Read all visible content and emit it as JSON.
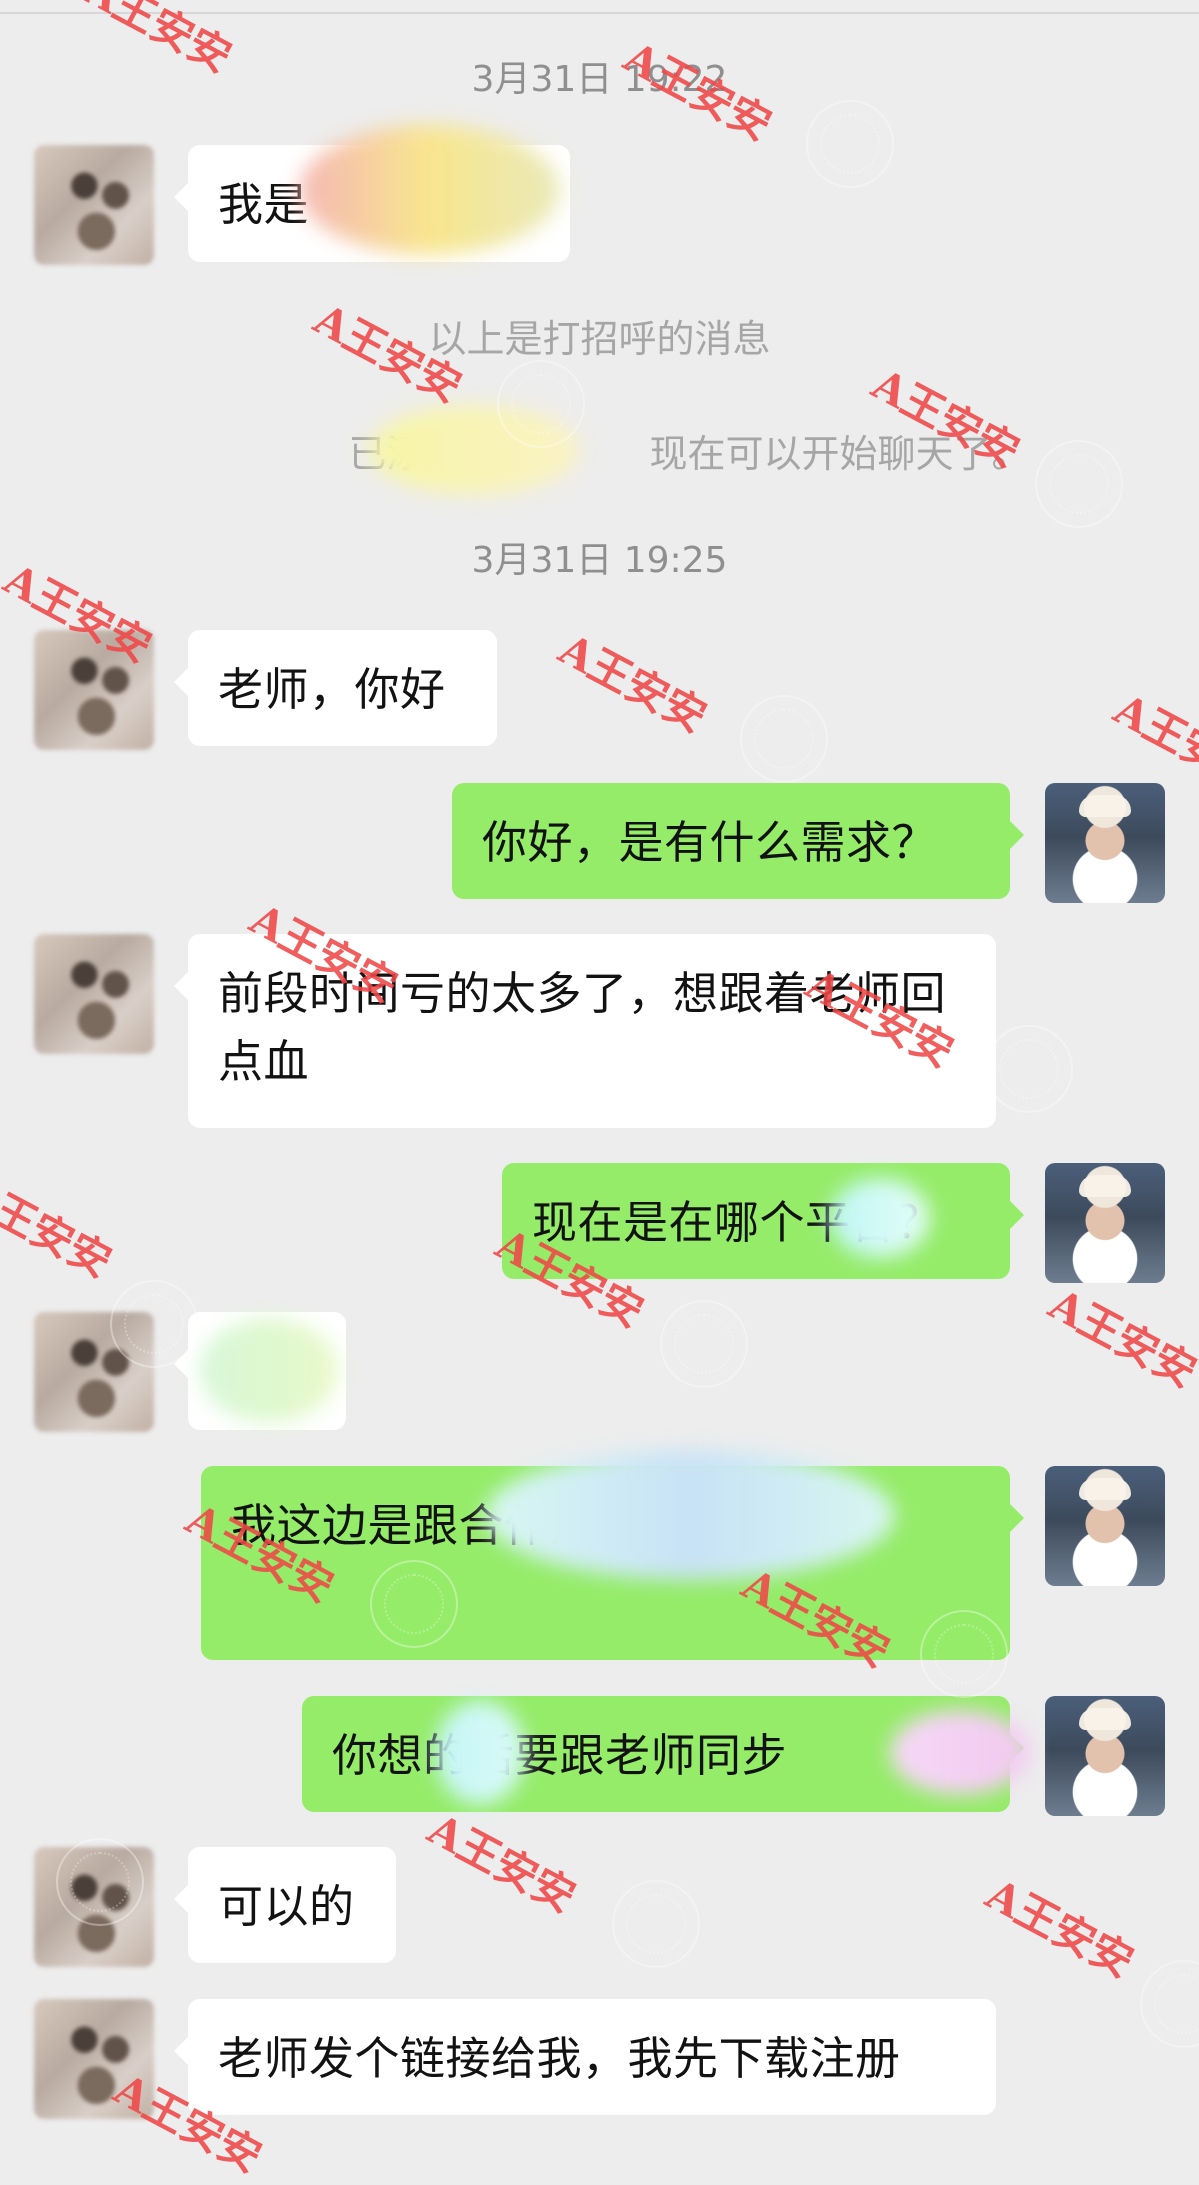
{
  "chat": {
    "top_timestamp": "3月31日 19:22",
    "greeting_text": "我是",
    "system_messages": [
      "以上是打招呼的消息",
      "已添加了",
      "现在可以开始聊天了。"
    ],
    "second_timestamp": "3月31日 19:25",
    "messages": [
      {
        "side": "left",
        "text": "老师，你好"
      },
      {
        "side": "right",
        "text": "你好，是有什么需求？"
      },
      {
        "side": "left",
        "text": "前段时间亏的太多了，想跟着老师回点血"
      },
      {
        "side": "right",
        "text": "现在是在哪个平台？"
      },
      {
        "side": "left",
        "text": ""
      },
      {
        "side": "right",
        "text": "我这边是跟合作的哦"
      },
      {
        "side": "right",
        "text": "你想的话要跟老师同步"
      },
      {
        "side": "left",
        "text": "可以的"
      },
      {
        "side": "left",
        "text": "老师发个链接给我，我先下载注册"
      }
    ],
    "watermark_text": "A王安安"
  }
}
